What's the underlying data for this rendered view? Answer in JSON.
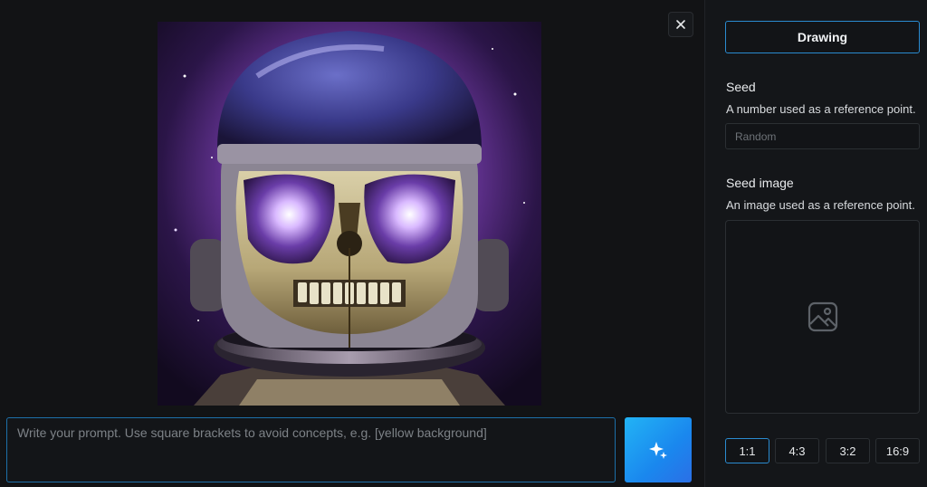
{
  "main": {
    "close_icon": "close-icon",
    "generated_image": {
      "subject": "astronaut-skull-helmet-artwork"
    },
    "prompt": {
      "value": "",
      "placeholder": "Write your prompt. Use square brackets to avoid concepts, e.g. [yellow background]"
    },
    "generate_icon": "sparkles-icon"
  },
  "sidebar": {
    "mode_label": "Drawing",
    "seed": {
      "label": "Seed",
      "description": "A number used as a reference point.",
      "placeholder": "Random"
    },
    "seed_image": {
      "label": "Seed image",
      "description": "An image used as a reference point.",
      "icon": "image-icon"
    },
    "aspect_ratios": [
      "1:1",
      "4:3",
      "3:2",
      "16:9"
    ],
    "selected_ratio": "1:1"
  },
  "colors": {
    "background": "#121315",
    "accent": "#2a8bd0",
    "generate_gradient_start": "#22b3f5",
    "generate_gradient_end": "#2b6fe6"
  }
}
